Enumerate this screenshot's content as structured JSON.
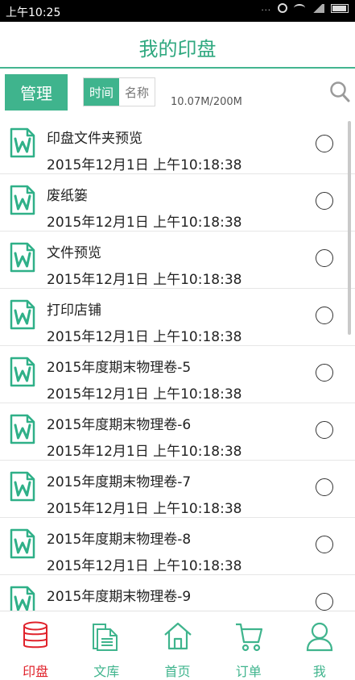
{
  "status_bar": {
    "time": "上午10:25",
    "dots": "..."
  },
  "header": {
    "title": "我的印盘"
  },
  "toolbar": {
    "manage_label": "管理",
    "sort_options": [
      "时间",
      "名称"
    ],
    "storage": "10.07M/200M"
  },
  "files": [
    {
      "name": "印盘文件夹预览",
      "date": "2015年12月1日 上午10:18:38"
    },
    {
      "name": "废纸篓",
      "date": "2015年12月1日 上午10:18:38"
    },
    {
      "name": "文件预览",
      "date": "2015年12月1日 上午10:18:38"
    },
    {
      "name": "打印店铺",
      "date": "2015年12月1日 上午10:18:38"
    },
    {
      "name": "2015年度期末物理卷-5",
      "date": "2015年12月1日 上午10:18:38"
    },
    {
      "name": "2015年度期末物理卷-6",
      "date": "2015年12月1日 上午10:18:38"
    },
    {
      "name": "2015年度期末物理卷-7",
      "date": "2015年12月1日 上午10:18:38"
    },
    {
      "name": "2015年度期末物理卷-8",
      "date": "2015年12月1日 上午10:18:38"
    },
    {
      "name": "2015年度期末物理卷-9",
      "date": ""
    }
  ],
  "tabs": [
    {
      "label": "印盘",
      "icon": "database-icon",
      "active": true
    },
    {
      "label": "文库",
      "icon": "documents-icon",
      "active": false
    },
    {
      "label": "首页",
      "icon": "home-icon",
      "active": false
    },
    {
      "label": "订单",
      "icon": "cart-icon",
      "active": false
    },
    {
      "label": "我",
      "icon": "user-icon",
      "active": false
    }
  ],
  "colors": {
    "accent": "#3fb48d",
    "title": "#2fa87f",
    "active_tab": "#e0222b"
  }
}
